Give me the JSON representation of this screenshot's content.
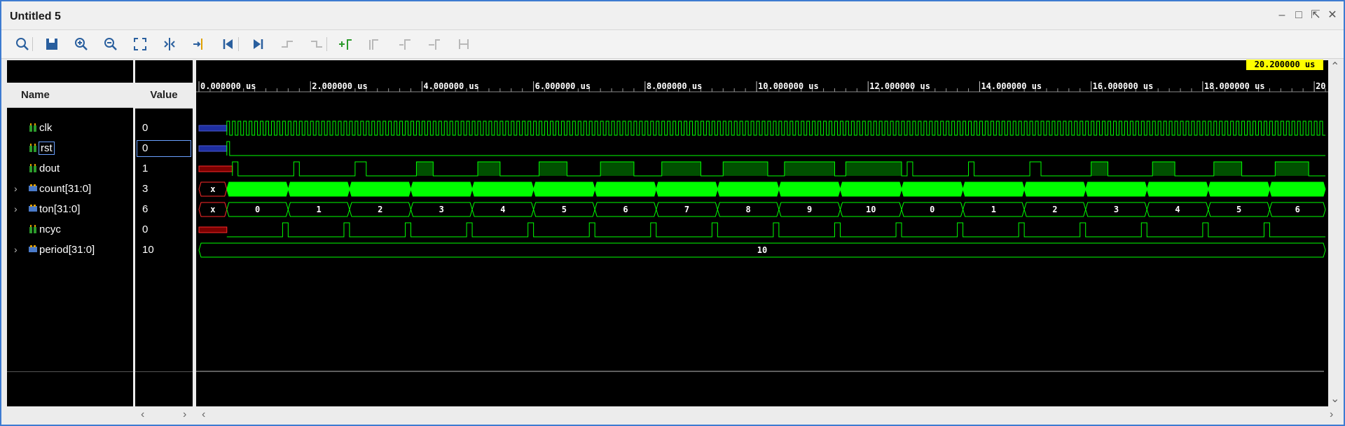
{
  "window": {
    "title": "Untitled 5",
    "controls": [
      "minimize",
      "maximize",
      "restore",
      "close"
    ]
  },
  "toolbar": {
    "buttons": [
      {
        "name": "search-icon",
        "enabled": true
      },
      {
        "name": "save-icon",
        "enabled": true
      },
      {
        "name": "zoom-in-icon",
        "enabled": true
      },
      {
        "name": "zoom-out-icon",
        "enabled": true
      },
      {
        "name": "zoom-fit-icon",
        "enabled": true
      },
      {
        "name": "cursor-to-zoom-icon",
        "enabled": true
      },
      {
        "name": "go-to-cursor-icon",
        "enabled": true
      },
      {
        "name": "go-to-time-zero-icon",
        "enabled": true
      },
      {
        "name": "go-to-last-time-icon",
        "enabled": true
      },
      {
        "name": "previous-transition-icon",
        "enabled": false
      },
      {
        "name": "next-transition-icon",
        "enabled": false
      },
      {
        "name": "add-marker-icon",
        "enabled": true
      },
      {
        "name": "previous-marker-icon",
        "enabled": false
      },
      {
        "name": "next-marker-icon",
        "enabled": false
      },
      {
        "name": "swap-cursors-icon",
        "enabled": false
      },
      {
        "name": "fix-cursor-icon",
        "enabled": false
      }
    ],
    "settings_icon": "gear-icon"
  },
  "columns": {
    "name": "Name",
    "value": "Value"
  },
  "signals": [
    {
      "name": "clk",
      "value": "0",
      "kind": "bit",
      "expandable": false
    },
    {
      "name": "rst",
      "value": "0",
      "kind": "bit",
      "expandable": false,
      "selected": true
    },
    {
      "name": "dout",
      "value": "1",
      "kind": "bit",
      "expandable": false
    },
    {
      "name": "count[31:0]",
      "value": "3",
      "kind": "bus",
      "expandable": true
    },
    {
      "name": "ton[31:0]",
      "value": "6",
      "kind": "bus",
      "expandable": true
    },
    {
      "name": "ncyc",
      "value": "0",
      "kind": "bit",
      "expandable": false
    },
    {
      "name": "period[31:0]",
      "value": "10",
      "kind": "bus",
      "expandable": true
    }
  ],
  "timeline": {
    "ticks": [
      "0.000000 us",
      "2.000000 us",
      "4.000000 us",
      "6.000000 us",
      "8.000000 us",
      "10.000000 us",
      "12.000000 us",
      "14.000000 us",
      "16.000000 us",
      "18.000000 us",
      "20"
    ],
    "cursor_label": "20.200000 us",
    "end_us": 20.2,
    "tick_step_us": 2
  },
  "waves": {
    "ton_values": [
      "x",
      "0",
      "1",
      "2",
      "3",
      "4",
      "5",
      "6",
      "7",
      "8",
      "9",
      "10",
      "0",
      "1",
      "2",
      "3",
      "4",
      "5",
      "6"
    ],
    "count_values": [
      "x"
    ],
    "period_values": [
      "10"
    ]
  },
  "colors": {
    "wave": "#00ff00",
    "wave_dark_fill": "#005000",
    "undefined": "#ff2a2a",
    "highz": "#1e2ea0",
    "cursor": "#ffff00",
    "background": "#000000"
  }
}
